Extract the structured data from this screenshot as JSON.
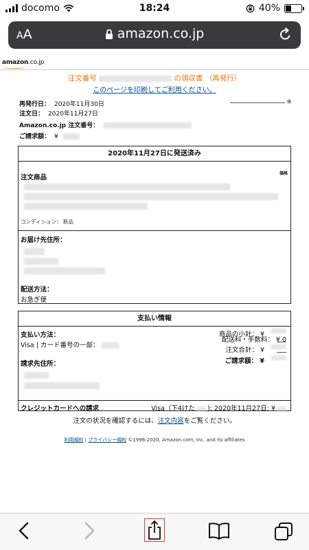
{
  "status_bar": {
    "carrier": "docomo",
    "time": "18:24",
    "battery": "40%",
    "battery_level": 0.4
  },
  "url_bar": {
    "aa_label_small": "A",
    "aa_label": "A",
    "domain": "amazon.co.jp"
  },
  "page": {
    "logo": {
      "brand": "amazon",
      "suffix": ".co.jp"
    },
    "title_prefix": "注文番号",
    "title_suffix": "の領収書 （再発行）",
    "print_link": "このページを印刷してご利用ください。",
    "honorific": "様",
    "reissue_label": "再発行日：",
    "reissue_date": "2020年11月30日",
    "order_date_label": "注文日：",
    "order_date": "2020年11月27日",
    "order_number_label": "Amazon.co.jp 注文番号：",
    "billing_amount_label": "ご請求額：",
    "currency": "¥",
    "shipment": {
      "header": "2020年11月27日に発送済み",
      "items_label": "注文商品",
      "price_label": "価格",
      "condition": "コンディション： 新品",
      "address_label": "お届け先住所：",
      "shipping_method_label": "配送方法：",
      "shipping_method": "お急ぎ便"
    },
    "payment": {
      "header": "支払い情報",
      "method_label": "支払い方法：",
      "method_value": "Visa | カード番号の一部：",
      "billing_address_label": "請求先住所：",
      "subtotal_label": "商品の小計：",
      "shipping_fee_label": "配送料・手数料：",
      "shipping_fee": "¥ 0",
      "order_total_label": "注文合計：",
      "billed_total_label": "ご請求額：",
      "yen": "¥",
      "credit_card_label": "クレジットカードへの請求",
      "card_charge_prefix": "Visa（下4けた",
      "card_charge_date": "): 2020年11月27日:",
      "card_charge_yen": "¥"
    },
    "footer": {
      "text_before": "注文の状況を確認するには、",
      "link": "注文内容",
      "text_after": "をご覧ください。",
      "terms": "利用規約",
      "privacy": "プライバシー規約",
      "copyright": "©1996-2020, Amazon.com, Inc. and its affiliates"
    }
  },
  "toolbar": {
    "buttons": [
      "back-icon",
      "forward-icon",
      "share-icon",
      "bookmarks-icon",
      "tabs-icon"
    ]
  }
}
